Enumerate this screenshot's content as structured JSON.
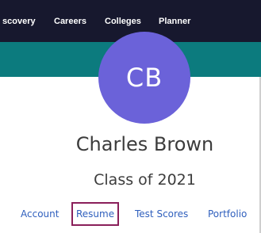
{
  "nav": {
    "items": [
      {
        "label": "scovery"
      },
      {
        "label": "Careers"
      },
      {
        "label": "Colleges"
      },
      {
        "label": "Planner"
      }
    ]
  },
  "profile": {
    "initials": "CB",
    "name": "Charles Brown",
    "class_year": "Class of 2021",
    "avatar_color": "#6b62d9"
  },
  "tabs": [
    {
      "label": "Account",
      "selected": false
    },
    {
      "label": "Resume",
      "selected": true
    },
    {
      "label": "Test Scores",
      "selected": false
    },
    {
      "label": "Portfolio",
      "selected": false
    }
  ],
  "colors": {
    "nav_bg": "#17182e",
    "banner": "#0c7b7e",
    "link": "#2f5fbd",
    "selected_outline": "#8a1f5a"
  }
}
